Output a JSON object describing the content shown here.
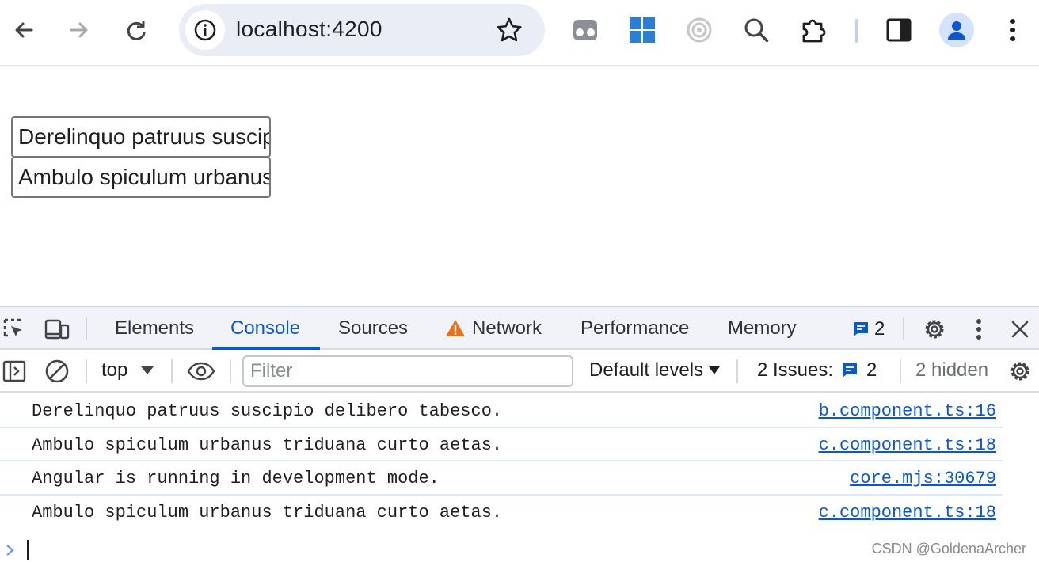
{
  "browser": {
    "url": "localhost:4200"
  },
  "page": {
    "buttons": [
      {
        "label": "Derelinquo patruus suscipio delibero tabesco."
      },
      {
        "label": "Ambulo spiculum urbanus triduana curto aetas."
      }
    ]
  },
  "devtools": {
    "tabs": [
      {
        "label": "Elements"
      },
      {
        "label": "Console"
      },
      {
        "label": "Sources"
      },
      {
        "label": "Network"
      },
      {
        "label": "Performance"
      },
      {
        "label": "Memory"
      }
    ],
    "active_tab": "Console",
    "message_count": "2",
    "console_bar": {
      "context": "top",
      "filter_placeholder": "Filter",
      "levels": "Default levels",
      "issues_label": "2 Issues:",
      "issues_count": "2",
      "hidden": "2 hidden"
    },
    "logs": [
      {
        "message": "Derelinquo patruus suscipio delibero tabesco.",
        "source": "b.component.ts:16"
      },
      {
        "message": "Ambulo spiculum urbanus triduana curto aetas.",
        "source": "c.component.ts:18"
      },
      {
        "message": "Angular is running in development mode.",
        "source": "core.mjs:30679"
      },
      {
        "message": "Ambulo spiculum urbanus triduana curto aetas.",
        "source": "c.component.ts:18"
      }
    ]
  },
  "watermark": "CSDN @GoldenaArcher",
  "colors": {
    "accent": "#0b57d0",
    "warning": "#e8711a",
    "toolbar_bg": "#f1f3f9",
    "omnibox_bg": "#e9edf6"
  }
}
